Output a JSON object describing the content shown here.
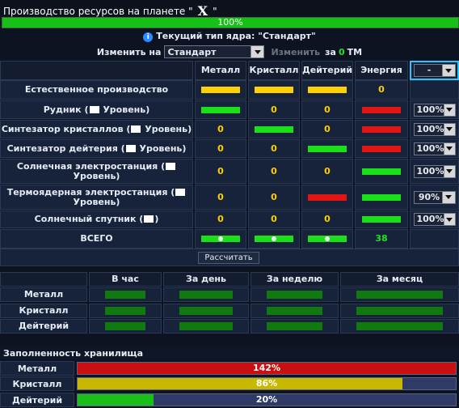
{
  "title": {
    "prefix": "Производство ресурсов на планете \"",
    "planet": "X",
    "suffix": "\""
  },
  "production_bar": {
    "label": "100%",
    "value": 1.0
  },
  "core": {
    "label": "Текущий тип ядра: \"Стандарт\""
  },
  "change": {
    "label": "Изменить на",
    "selected": "Стандарт",
    "button": "Изменить",
    "cost_prefix": "за",
    "cost_value": "0",
    "cost_unit": "ТМ"
  },
  "colors": {
    "green": "#19e019",
    "yellow": "#ffd000",
    "red": "#e21515",
    "dark_green": "#107a10"
  },
  "headers": {
    "metal": "Металл",
    "crystal": "Кристалл",
    "deuterium": "Дейтерий",
    "energy": "Энергия",
    "global_select": "-"
  },
  "rows": [
    {
      "name": "Естественное производство",
      "metal": "yellow-bar",
      "crystal": "yellow-bar",
      "deut": "yellow-bar",
      "energy": "0",
      "pct": ""
    },
    {
      "name_parts": [
        "Рудник (",
        " Уровень)"
      ],
      "metal": "green-bar",
      "crystal": "0",
      "deut": "0",
      "energy": "red-bar",
      "pct": "100%"
    },
    {
      "name_parts": [
        "Синтезатор кристаллов (",
        " Уровень)"
      ],
      "metal": "0",
      "crystal": "green-bar",
      "deut": "0",
      "energy": "red-bar",
      "pct": "100%"
    },
    {
      "name_parts": [
        "Синтезатор дейтерия (",
        " Уровень)"
      ],
      "metal": "0",
      "crystal": "0",
      "deut": "green-bar",
      "energy": "red-bar",
      "pct": "100%"
    },
    {
      "name_parts": [
        "Солнечная электростанция (",
        " Уровень)"
      ],
      "metal": "0",
      "crystal": "0",
      "deut": "0",
      "energy": "green-bar",
      "pct": "100%"
    },
    {
      "name_parts": [
        "Термоядерная электростанция (",
        " Уровень)"
      ],
      "metal": "0",
      "crystal": "0",
      "deut": "red-bar",
      "energy": "green-bar",
      "pct": "90%"
    },
    {
      "name_parts": [
        "Солнечный спутник (",
        ")"
      ],
      "metal": "0",
      "crystal": "0",
      "deut": "0",
      "energy": "green-bar",
      "pct": "100%"
    }
  ],
  "total": {
    "label": "ВСЕГО",
    "energy": "38"
  },
  "calc_button": "Рассчитать",
  "period_headers": [
    "В час",
    "За день",
    "За неделю",
    "За месяц"
  ],
  "period_rows": [
    "Металл",
    "Кристалл",
    "Дейтерий"
  ],
  "storage": {
    "title": "Заполненность хранилища",
    "rows": [
      {
        "name": "Металл",
        "label": "142%",
        "fill": 1.0,
        "color": "#c81010"
      },
      {
        "name": "Кристалл",
        "label": "86%",
        "fill": 0.86,
        "color": "#c8b800"
      },
      {
        "name": "Дейтерий",
        "label": "20%",
        "fill": 0.2,
        "color": "#19c019"
      }
    ]
  }
}
